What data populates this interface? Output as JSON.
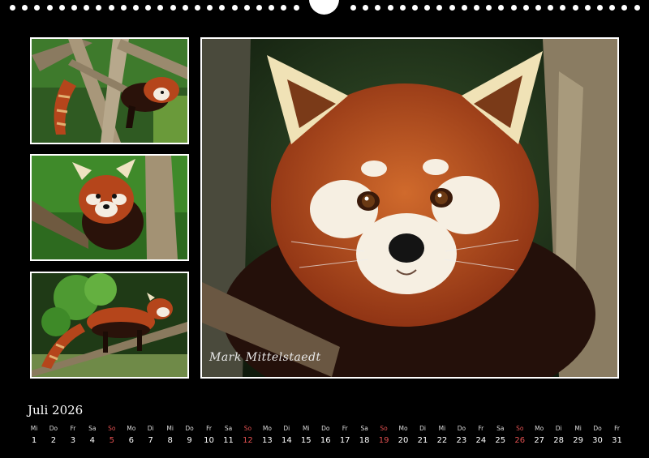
{
  "calendar": {
    "month_title": "Juli 2026",
    "days": [
      {
        "wd": "Mi",
        "n": "1"
      },
      {
        "wd": "Do",
        "n": "2"
      },
      {
        "wd": "Fr",
        "n": "3"
      },
      {
        "wd": "Sa",
        "n": "4"
      },
      {
        "wd": "So",
        "n": "5",
        "sun": true
      },
      {
        "wd": "Mo",
        "n": "6"
      },
      {
        "wd": "Di",
        "n": "7"
      },
      {
        "wd": "Mi",
        "n": "8"
      },
      {
        "wd": "Do",
        "n": "9"
      },
      {
        "wd": "Fr",
        "n": "10"
      },
      {
        "wd": "Sa",
        "n": "11"
      },
      {
        "wd": "So",
        "n": "12",
        "sun": true
      },
      {
        "wd": "Mo",
        "n": "13"
      },
      {
        "wd": "Di",
        "n": "14"
      },
      {
        "wd": "Mi",
        "n": "15"
      },
      {
        "wd": "Do",
        "n": "16"
      },
      {
        "wd": "Fr",
        "n": "17"
      },
      {
        "wd": "Sa",
        "n": "18"
      },
      {
        "wd": "So",
        "n": "19",
        "sun": true
      },
      {
        "wd": "Mo",
        "n": "20"
      },
      {
        "wd": "Di",
        "n": "21"
      },
      {
        "wd": "Mi",
        "n": "22"
      },
      {
        "wd": "Do",
        "n": "23"
      },
      {
        "wd": "Fr",
        "n": "24"
      },
      {
        "wd": "Sa",
        "n": "25"
      },
      {
        "wd": "So",
        "n": "26",
        "sun": true
      },
      {
        "wd": "Mo",
        "n": "27"
      },
      {
        "wd": "Di",
        "n": "28"
      },
      {
        "wd": "Mi",
        "n": "29"
      },
      {
        "wd": "Do",
        "n": "30"
      },
      {
        "wd": "Fr",
        "n": "31"
      }
    ]
  },
  "photos": {
    "signature": "Mark Mittelstaedt"
  },
  "colors": {
    "sunday": "#e05050",
    "background": "#000000",
    "fur": "#b5451b"
  }
}
